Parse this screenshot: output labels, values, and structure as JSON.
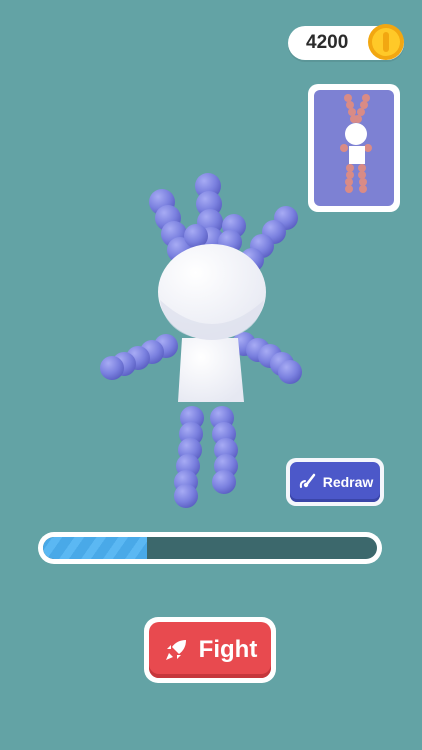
{
  "hud": {
    "coins": "4200",
    "coin_icon": "gold-coin-icon"
  },
  "preview": {
    "description_icon": "enemy-preview"
  },
  "character": {
    "color": "#7c82e0",
    "body_color": "#ffffff"
  },
  "redraw_button": {
    "label": "Redraw",
    "icon": "brush-icon"
  },
  "progress": {
    "value": 0.31
  },
  "fight_button": {
    "label": "Fight",
    "icon": "rocket-icon"
  },
  "colors": {
    "background": "#63a3a5",
    "accent_red": "#e84a4f",
    "accent_blue": "#4c58c9",
    "progress_fill": "#49a9e8"
  }
}
